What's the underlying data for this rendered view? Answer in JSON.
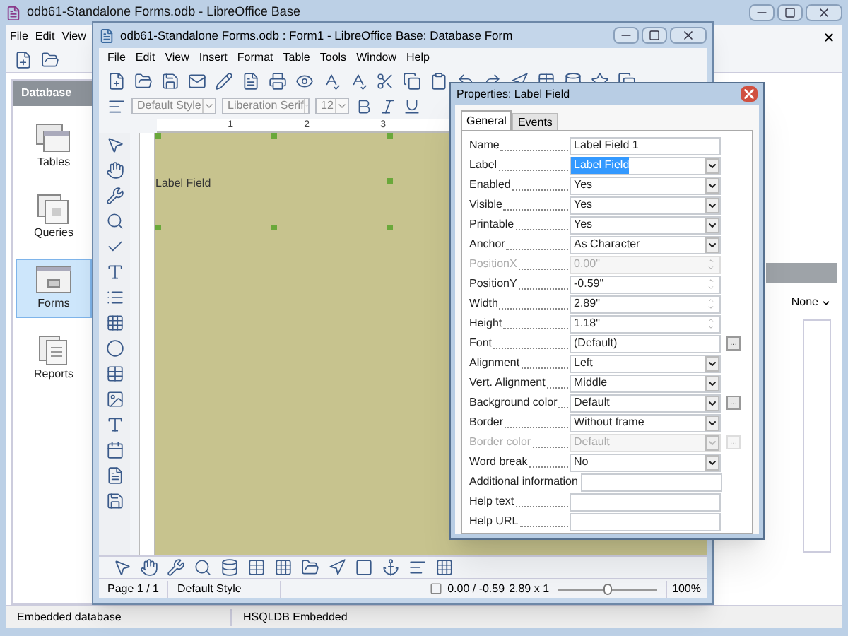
{
  "main_window": {
    "title": "odb61-Standalone Forms.odb - LibreOffice Base",
    "menu": [
      "File",
      "Edit",
      "View"
    ],
    "sidebar": {
      "header": "Database",
      "items": [
        {
          "label": "Tables",
          "kind": "table",
          "selected": false
        },
        {
          "label": "Queries",
          "kind": "query",
          "selected": false
        },
        {
          "label": "Forms",
          "kind": "form",
          "selected": true
        },
        {
          "label": "Reports",
          "kind": "report",
          "selected": false
        }
      ]
    },
    "right_panel": {
      "dropdown": "None"
    },
    "status_bar": [
      "Embedded database",
      "HSQLDB Embedded"
    ]
  },
  "form_window": {
    "title": "odb61-Standalone Forms.odb : Form1 - LibreOffice Base: Database Form",
    "menu": [
      "File",
      "Edit",
      "View",
      "Insert",
      "Format",
      "Table",
      "Tools",
      "Window",
      "Help"
    ],
    "style_box": "Default Style",
    "font_box": "Liberation Serif",
    "size_box": "12",
    "ruler_marks": [
      "1",
      "2",
      "3"
    ],
    "label_field": "Label Field",
    "status_bar": {
      "page": "Page 1 / 1",
      "style": "Default Style",
      "position": "0.00 / -0.59",
      "size": "2.89 x 1",
      "zoom": "100%",
      "zoom_slider": {
        "level": 0.5
      }
    }
  },
  "properties": {
    "title": "Properties: Label Field",
    "tabs": [
      {
        "label": "General",
        "selected": true
      },
      {
        "label": "Events",
        "selected": false
      }
    ],
    "rows": [
      {
        "label": "Name",
        "kind": "text",
        "value": "Label Field 1",
        "disabled": false
      },
      {
        "label": "Label",
        "kind": "list",
        "value": "Label Field",
        "disabled": false,
        "highlighted": true
      },
      {
        "label": "Enabled",
        "kind": "list",
        "value": "Yes",
        "disabled": false
      },
      {
        "label": "Visible",
        "kind": "list",
        "value": "Yes",
        "disabled": false
      },
      {
        "label": "Printable",
        "kind": "list",
        "value": "Yes",
        "disabled": false
      },
      {
        "label": "Anchor",
        "kind": "list",
        "value": "As Character",
        "disabled": false
      },
      {
        "label": "PositionX",
        "kind": "spin",
        "value": "0.00\"",
        "disabled": true
      },
      {
        "label": "PositionY",
        "kind": "spin",
        "value": "-0.59\"",
        "disabled": false
      },
      {
        "label": "Width",
        "kind": "spin",
        "value": "2.89\"",
        "disabled": false
      },
      {
        "label": "Height",
        "kind": "spin",
        "value": "1.18\"",
        "disabled": false
      },
      {
        "label": "Font",
        "kind": "text",
        "value": "(Default)",
        "button": "...",
        "disabled": false
      },
      {
        "label": "Alignment",
        "kind": "list",
        "value": "Left",
        "disabled": false
      },
      {
        "label": "Vert. Alignment",
        "kind": "list",
        "value": "Middle",
        "disabled": false
      },
      {
        "label": "Background color",
        "kind": "list",
        "value": "Default",
        "button": "...",
        "disabled": false
      },
      {
        "label": "Border",
        "kind": "list",
        "value": "Without frame",
        "disabled": false
      },
      {
        "label": "Border color",
        "kind": "list",
        "value": "Default",
        "button": "...",
        "disabled": true
      },
      {
        "label": "Word break",
        "kind": "list",
        "value": "No",
        "disabled": false
      },
      {
        "label": "Additional information",
        "kind": "text",
        "disabled": false
      },
      {
        "label": "Help text",
        "kind": "text",
        "disabled": false
      },
      {
        "label": "Help URL",
        "kind": "text",
        "disabled": false
      }
    ]
  }
}
